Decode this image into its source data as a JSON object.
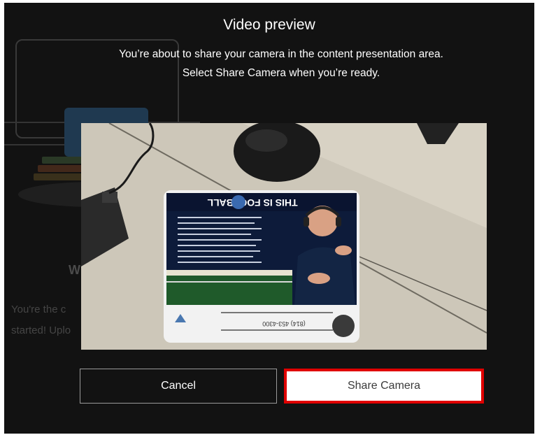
{
  "dialog": {
    "title": "Video preview",
    "message_line1": "You’re about to share your camera in the content presentation area.",
    "message_line2": "Select Share Camera when you’re ready."
  },
  "background": {
    "heading_fragment": "W",
    "line1_fragment": "You're the c",
    "line2_fragment": "started! Uplo"
  },
  "preview": {
    "mousepad_banner": "THIS IS FOOTBALL",
    "mousepad_phone": "(814) 453-4300"
  },
  "buttons": {
    "cancel_label": "Cancel",
    "share_label": "Share Camera"
  },
  "colors": {
    "backdrop": "#121212",
    "share_highlight": "#e00000",
    "text": "#ffffff"
  }
}
